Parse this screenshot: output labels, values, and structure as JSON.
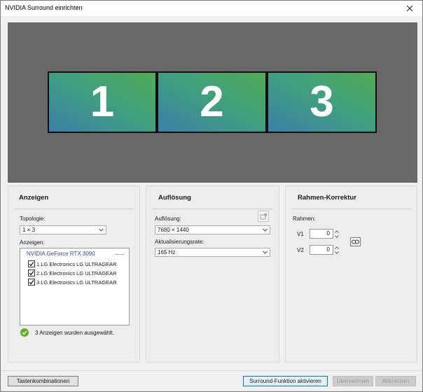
{
  "window": {
    "title": "NVIDIA Surround einrichten"
  },
  "preview": {
    "monitors": [
      "1",
      "2",
      "3"
    ]
  },
  "panels": {
    "anzeigen": {
      "title": "Anzeigen",
      "topologie_label": "Topologie:",
      "topologie_value": "1 × 3",
      "anzeigen_label": "Anzeigen:",
      "gpu": "NVIDIA GeForce RTX 3090",
      "displays": [
        {
          "label": "1.LG Electronics LG ULTRAGEAR",
          "checked": true
        },
        {
          "label": "2.LG Electronics LG ULTRAGEAR",
          "checked": true
        },
        {
          "label": "3.LG Electronics LG ULTRAGEAR",
          "checked": true
        }
      ],
      "status": "3 Anzeigen wurden ausgewählt."
    },
    "aufloesung": {
      "title": "Auflösung",
      "resolution_label": "Auflösung:",
      "resolution_value": "7680 × 1440",
      "refresh_label": "Aktualisierungsrate:",
      "refresh_value": "165 Hz"
    },
    "rahmen": {
      "title": "Rahmen-Korrektur",
      "rahmen_label": "Rahmen:",
      "v1_label": "V1",
      "v1_value": "0",
      "v2_label": "V2",
      "v2_value": "0"
    }
  },
  "footer": {
    "shortcuts": "Tastenkombinationen",
    "activate": "Surround-Funktion aktivieren",
    "apply": "Übernehmen",
    "cancel": "Abbrechen"
  },
  "colors": {
    "accent": "#0078d7",
    "gpu_text": "#3b4a9a",
    "ok_green": "#5fb11f",
    "preview_bg": "#686868"
  }
}
